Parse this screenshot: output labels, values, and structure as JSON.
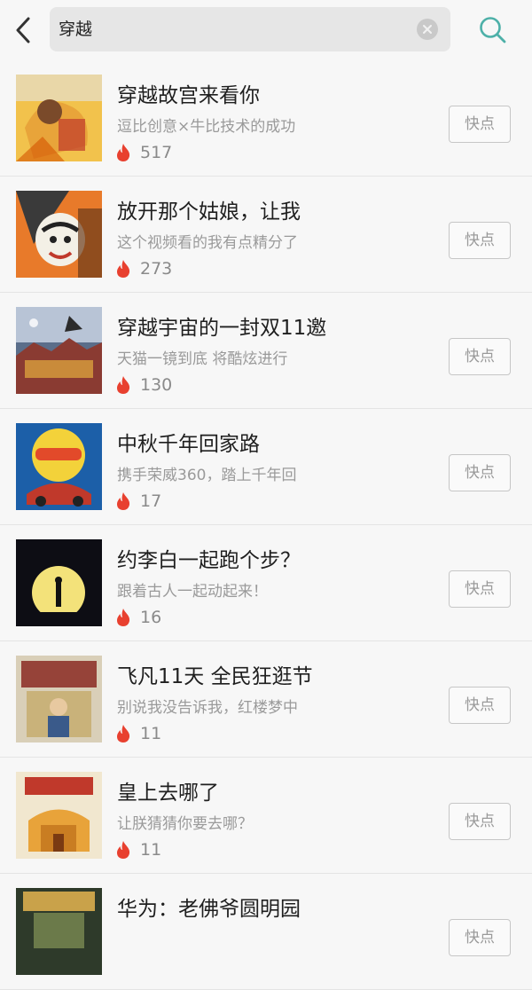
{
  "search": {
    "query": "穿越"
  },
  "colors": {
    "flame": "#e8402f",
    "search_icon": "#4db0a8"
  },
  "items": [
    {
      "title": "穿越故宫来看你",
      "desc": "逗比创意×牛比技术的成功",
      "count": "517",
      "button": "快点",
      "thumb": "palace-comic"
    },
    {
      "title": "放开那个姑娘，让我",
      "desc": "这个视频看的我有点精分了",
      "count": "273",
      "button": "快点",
      "thumb": "opera-face"
    },
    {
      "title": "穿越宇宙的一封双11邀",
      "desc": "天猫一镜到底 将酷炫进行",
      "count": "130",
      "button": "快点",
      "thumb": "space-palace"
    },
    {
      "title": "中秋千年回家路",
      "desc": "携手荣威360，踏上千年回",
      "count": "17",
      "button": "快点",
      "thumb": "car-poster"
    },
    {
      "title": "约李白一起跑个步？",
      "desc": "跟着古人一起动起来！",
      "count": "16",
      "button": "快点",
      "thumb": "moon-runner"
    },
    {
      "title": "飞凡11天 全民狂逛节",
      "desc": "别说我没告诉我，红楼梦中",
      "count": "11",
      "button": "快点",
      "thumb": "scholar-poster"
    },
    {
      "title": "皇上去哪了",
      "desc": "让朕猜猜你要去哪？",
      "count": "11",
      "button": "快点",
      "thumb": "golden-palace"
    },
    {
      "title": "华为：老佛爷圆明园",
      "desc": "",
      "count": "",
      "button": "快点",
      "thumb": "garden-palace"
    }
  ]
}
